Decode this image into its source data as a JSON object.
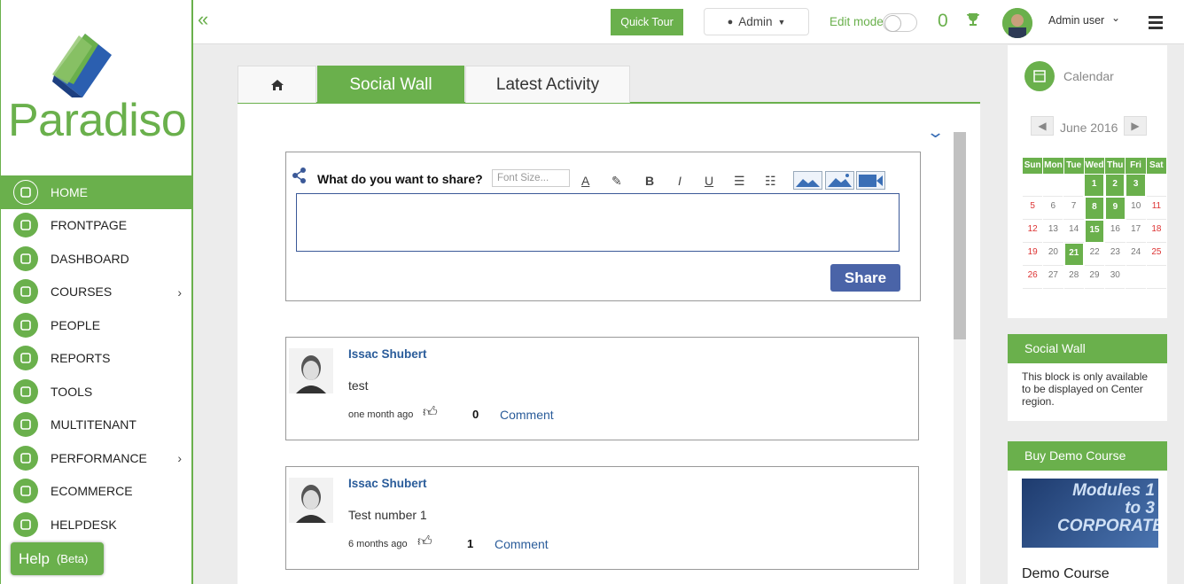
{
  "brand": {
    "logo_text": "Paradiso",
    "accent": "#6ab04c",
    "link": "#2a5c9a"
  },
  "sidebar": {
    "items": [
      {
        "label": "HOME",
        "icon": "home-icon",
        "active": true
      },
      {
        "label": "FRONTPAGE",
        "icon": "frontpage-icon"
      },
      {
        "label": "DASHBOARD",
        "icon": "dashboard-icon"
      },
      {
        "label": "COURSES",
        "icon": "folder-icon",
        "submenu": true
      },
      {
        "label": "PEOPLE",
        "icon": "people-icon"
      },
      {
        "label": "REPORTS",
        "icon": "chart-icon"
      },
      {
        "label": "TOOLS",
        "icon": "tools-icon"
      },
      {
        "label": "MULTITENANT",
        "icon": "multitenant-icon"
      },
      {
        "label": "PERFORMANCE",
        "icon": "gauge-icon",
        "submenu": true
      },
      {
        "label": "ECOMMERCE",
        "icon": "cart-icon"
      },
      {
        "label": "HELPDESK",
        "icon": "chat-icon"
      }
    ],
    "chevron": "›"
  },
  "help": {
    "label": "Help",
    "badge": "(Beta)"
  },
  "topbar": {
    "collapse": "«",
    "quick_tour": "Quick Tour",
    "role": "Admin",
    "edit_mode": "Edit mode",
    "points": "0",
    "username": "Admin user"
  },
  "tabs": [
    {
      "label": "",
      "icon": "home-icon"
    },
    {
      "label": "Social Wall",
      "active": true
    },
    {
      "label": "Latest Activity"
    }
  ],
  "composer": {
    "label": "What do you want to share?",
    "font_size_placeholder": "Font Size...",
    "tools": [
      "A",
      "✎",
      "B",
      "I",
      "U",
      "☰",
      "☷"
    ],
    "share": "Share"
  },
  "posts": [
    {
      "author": "Issac Shubert",
      "body": "test",
      "time": "one month ago",
      "likes": "0",
      "comment": "Comment"
    },
    {
      "author": "Issac Shubert",
      "body": "Test number 1",
      "time": "6 months ago",
      "likes": "1",
      "comment": "Comment"
    }
  ],
  "calendar": {
    "title": "Calendar",
    "month": "June 2016",
    "prev": "◀",
    "next": "▶",
    "days": [
      "Sun",
      "Mon",
      "Tue",
      "Wed",
      "Thu",
      "Fri",
      "Sat"
    ],
    "weeks": [
      [
        "",
        "",
        "",
        "1",
        "2",
        "3",
        ""
      ],
      [
        "5",
        "6",
        "7",
        "8",
        "9",
        "10",
        "11"
      ],
      [
        "12",
        "13",
        "14",
        "15",
        "16",
        "17",
        "18"
      ],
      [
        "19",
        "20",
        "21",
        "22",
        "23",
        "24",
        "25"
      ],
      [
        "26",
        "27",
        "28",
        "29",
        "30",
        "",
        ""
      ]
    ],
    "highlighted": [
      "1",
      "2",
      "3",
      "8",
      "9",
      "15",
      "21"
    ]
  },
  "social_block": {
    "title": "Social Wall",
    "text": "This block is only available to be displayed on Center region."
  },
  "demo_block": {
    "title": "Buy Demo Course",
    "image_text": "Modules 1 to 3 CORPORATE",
    "course": "Demo Course"
  }
}
